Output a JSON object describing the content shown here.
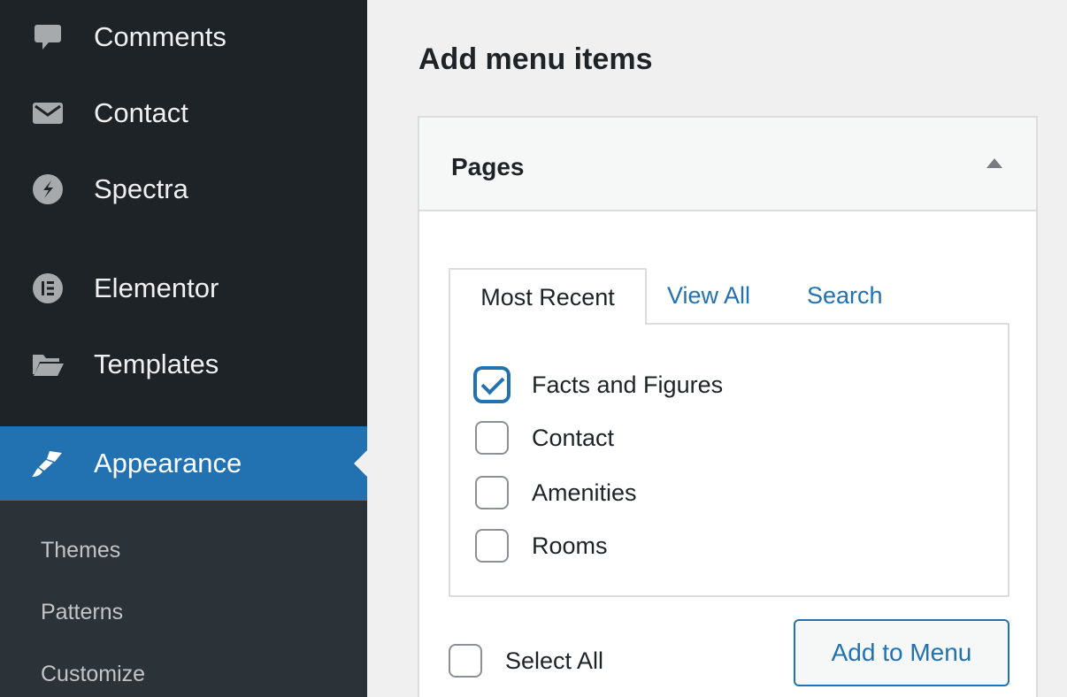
{
  "sidebar": {
    "items": [
      {
        "label": "Comments",
        "icon": "comment-icon"
      },
      {
        "label": "Contact",
        "icon": "envelope-icon"
      },
      {
        "label": "Spectra",
        "icon": "spectra-icon"
      },
      {
        "label": "Elementor",
        "icon": "elementor-icon"
      },
      {
        "label": "Templates",
        "icon": "folder-icon"
      },
      {
        "label": "Appearance",
        "icon": "paintbrush-icon"
      }
    ],
    "submenu": [
      "Themes",
      "Patterns",
      "Customize"
    ]
  },
  "main": {
    "title": "Add menu items",
    "panel": {
      "title": "Pages",
      "tabs": [
        "Most Recent",
        "View All",
        "Search"
      ],
      "pages": [
        {
          "label": "Facts and Figures",
          "checked": true
        },
        {
          "label": "Contact",
          "checked": false
        },
        {
          "label": "Amenities",
          "checked": false
        },
        {
          "label": "Rooms",
          "checked": false
        }
      ],
      "select_all_label": "Select All",
      "add_button_label": "Add to Menu"
    }
  },
  "colors": {
    "sidebar_bg": "#1d2327",
    "accent": "#2271b1",
    "submenu_bg": "#2c3338"
  }
}
